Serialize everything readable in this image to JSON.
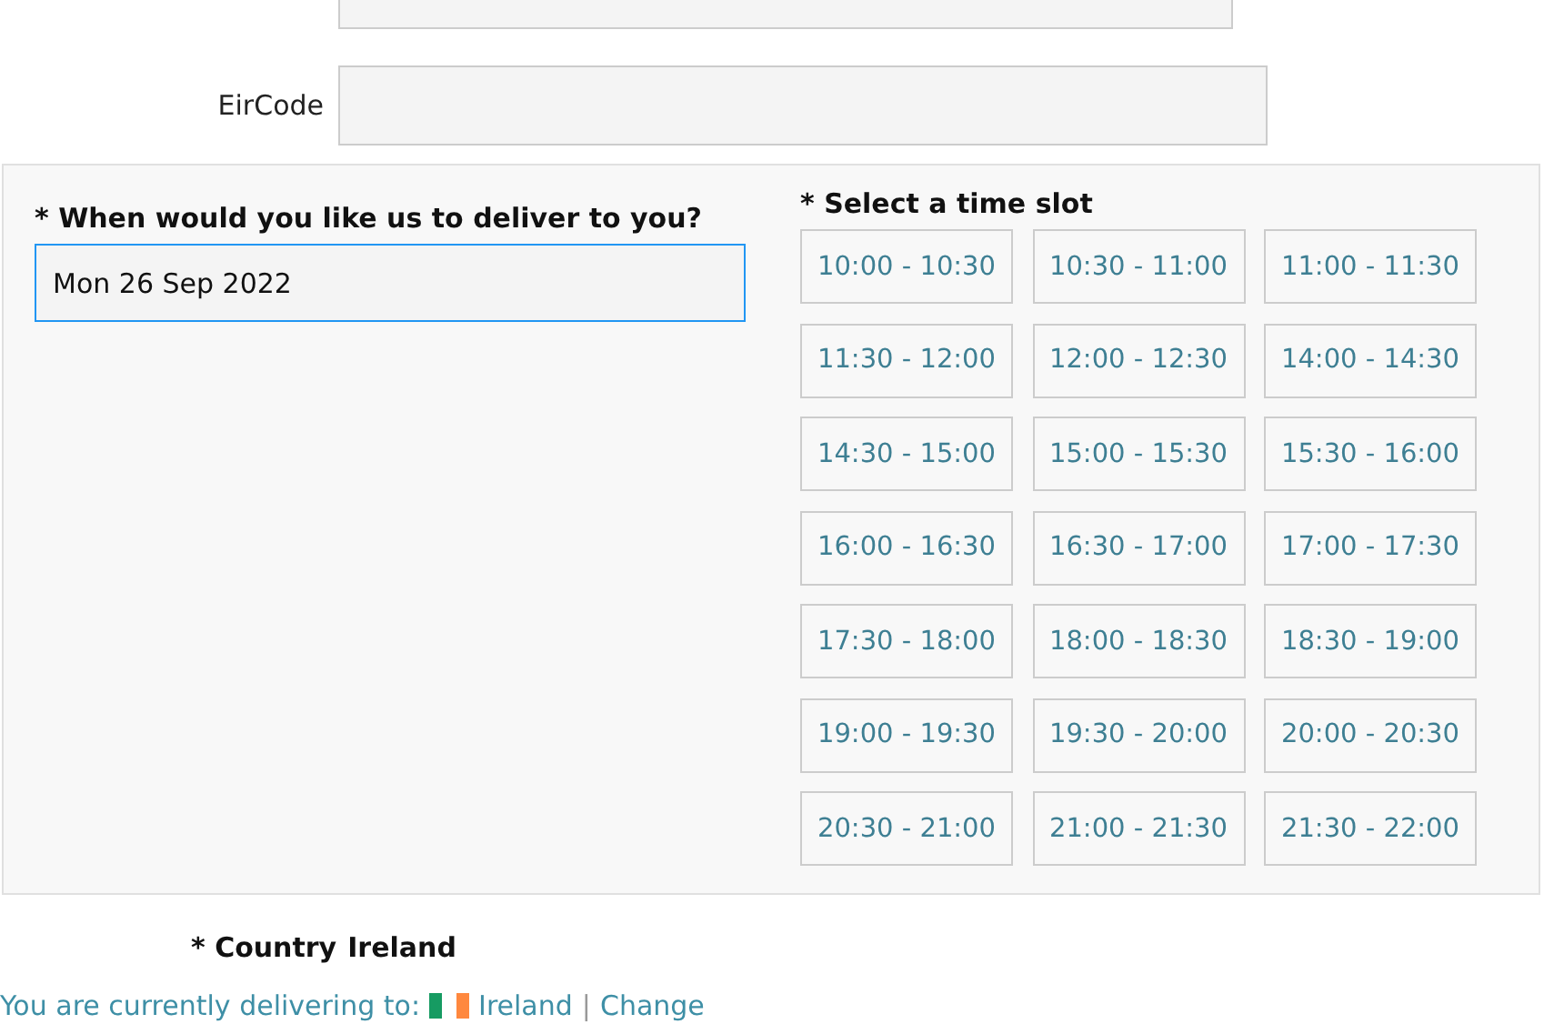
{
  "eircode": {
    "label": "EirCode"
  },
  "delivery": {
    "date_label": "* When would you like us to deliver to you?",
    "date_value": "Mon 26 Sep 2022",
    "slot_label": "* Select a time slot",
    "slots": [
      "10:00 - 10:30",
      "10:30 - 11:00",
      "11:00 - 11:30",
      "11:30 - 12:00",
      "12:00 - 12:30",
      "14:00 - 14:30",
      "14:30 - 15:00",
      "15:00 - 15:30",
      "15:30 - 16:00",
      "16:00 - 16:30",
      "16:30 - 17:00",
      "17:00 - 17:30",
      "17:30 - 18:00",
      "18:00 - 18:30",
      "18:30 - 19:00",
      "19:00 - 19:30",
      "19:30 - 20:00",
      "20:00 - 20:30",
      "20:30 - 21:00",
      "21:00 - 21:30",
      "21:30 - 22:00"
    ]
  },
  "country": {
    "label": "* Country",
    "value": "Ireland"
  },
  "footer": {
    "text": "You are currently delivering to:",
    "country": "Ireland",
    "separator": "|",
    "change": "Change"
  }
}
